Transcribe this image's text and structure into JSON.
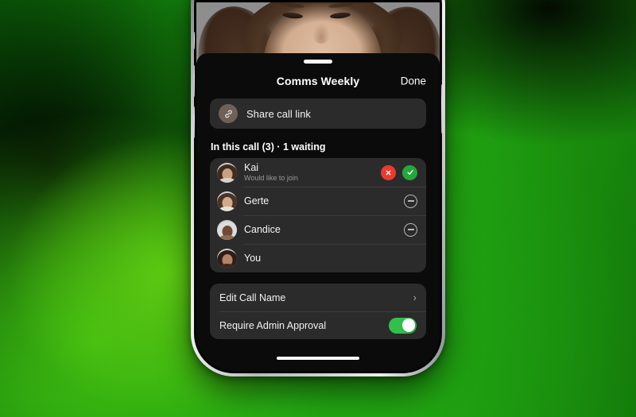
{
  "sheet": {
    "title": "Comms Weekly",
    "done_label": "Done",
    "share": {
      "label": "Share call link",
      "icon": "link-icon"
    },
    "section_header": "In this call (3) · 1 waiting",
    "participants": [
      {
        "name": "Kai",
        "subtitle": "Would like to join",
        "waiting": true,
        "decline_icon": "close-icon",
        "accept_icon": "check-icon"
      },
      {
        "name": "Gerte",
        "subtitle": "",
        "waiting": false,
        "remove_icon": "minus-circle-icon"
      },
      {
        "name": "Candice",
        "subtitle": "",
        "waiting": false,
        "remove_icon": "minus-circle-icon"
      },
      {
        "name": "You",
        "subtitle": "",
        "waiting": false,
        "remove_icon": ""
      }
    ],
    "settings": [
      {
        "label": "Edit Call Name",
        "control": "chevron",
        "chevron": "›"
      },
      {
        "label": "Require Admin Approval",
        "control": "toggle",
        "toggle_on": true
      }
    ]
  },
  "colors": {
    "accent_green": "#31c14b",
    "decline_red": "#ea3b2e",
    "accept_green": "#23a83c",
    "sheet_bg": "#0b0b0b",
    "card_bg": "#2b2b2b",
    "background_green": "#1a9c0f"
  }
}
